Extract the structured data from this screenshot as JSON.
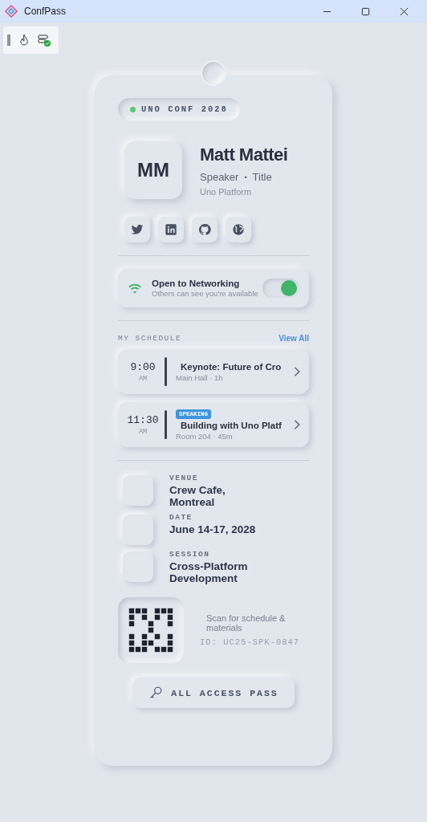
{
  "window": {
    "title": "ConfPass"
  },
  "badge": {
    "label": "UNO CONF 2028",
    "color": "#5cc97a"
  },
  "profile": {
    "initials": "MM",
    "name": "Matt Mattei",
    "role": "Speaker",
    "separator": "•",
    "title": "Title",
    "company": "Uno Platform"
  },
  "socials": [
    {
      "kind": "twitter"
    },
    {
      "kind": "linkedin"
    },
    {
      "kind": "github"
    },
    {
      "kind": "web"
    }
  ],
  "networking": {
    "title": "Open to Networking",
    "subtitle": "Others can see you're available",
    "on": true
  },
  "schedule": {
    "heading": "MY SCHEDULE",
    "view_all": "View All",
    "items": [
      {
        "time": "9:00",
        "period": "AM",
        "title": "Keynote: Future of Cro",
        "detail": "Main Hall · 1h"
      },
      {
        "time": "11:30",
        "period": "AM",
        "tag": "SPEAKING",
        "title": "Building with Uno Platf",
        "detail": "Room 204 · 45m"
      }
    ]
  },
  "details": [
    {
      "label": "VENUE",
      "value": "Crew Cafe, Montreal"
    },
    {
      "label": "DATE",
      "value": "June 14-17, 2028"
    },
    {
      "label": "SESSION",
      "value": "Cross-Platform Development"
    }
  ],
  "scan": {
    "caption": "Scan for schedule & materials",
    "id": "ID: UC25-SPK-0847"
  },
  "pass_button": {
    "label": "ALL ACCESS PASS"
  }
}
